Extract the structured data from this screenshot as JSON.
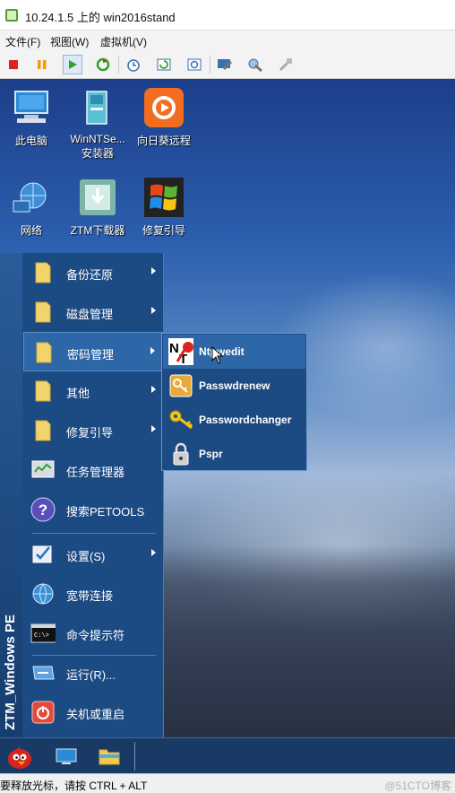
{
  "window": {
    "title": "10.24.1.5 上的 win2016stand"
  },
  "menubar": {
    "file": "文件(F)",
    "view": "视图(W)",
    "vm": "虚拟机(V)"
  },
  "toolbar": {
    "icons": [
      "stop-icon",
      "pause-icon",
      "play-icon",
      "reset-icon",
      "snapshot-icon",
      "revert-icon",
      "snapshot-manager-icon",
      "settings-icon",
      "tools-icon",
      "disabled-tools-icon"
    ]
  },
  "desktop": {
    "icons": [
      {
        "label": "此电脑",
        "icon": "computer-icon"
      },
      {
        "label": "WinNTSe...\n安装器",
        "label1": "WinNTSe...",
        "label2": "安装器",
        "icon": "installer-icon"
      },
      {
        "label": "向日葵远程",
        "icon": "sunflower-icon"
      },
      {
        "label": "网络",
        "icon": "network-icon"
      },
      {
        "label": "ZTM下载器",
        "icon": "download-icon"
      },
      {
        "label": "修复引导",
        "icon": "windows-icon"
      }
    ]
  },
  "startmenu": {
    "brand": "ZTM_Windows PE",
    "items": [
      {
        "label": "备份还原",
        "submenu": true
      },
      {
        "label": "磁盘管理",
        "submenu": true
      },
      {
        "label": "密码管理",
        "submenu": true,
        "highlighted": true
      },
      {
        "label": "其他",
        "submenu": true
      },
      {
        "label": "修复引导",
        "submenu": true
      },
      {
        "label": "任务管理器",
        "submenu": false
      },
      {
        "label": "搜索PETOOLS",
        "submenu": false
      },
      {
        "label": "设置(S)",
        "submenu": true
      },
      {
        "label": "宽带连接",
        "submenu": false
      },
      {
        "label": "命令提示符",
        "submenu": false
      },
      {
        "label": "运行(R)...",
        "submenu": false
      },
      {
        "label": "关机或重启",
        "submenu": false
      }
    ]
  },
  "submenu": {
    "items": [
      {
        "label": "Ntpwedit",
        "highlighted": true
      },
      {
        "label": "Passwdrenew"
      },
      {
        "label": "Passwordchanger"
      },
      {
        "label": "Pspr"
      }
    ]
  },
  "taskbar": {
    "items": [
      "angry-bird-icon",
      "desktop-icon",
      "folder-icon"
    ]
  },
  "statusbar": {
    "text": "要释放光标，请按 CTRL + ALT",
    "watermark": "@51CTO博客"
  },
  "colors": {
    "menu_bg": "#1c4a82",
    "highlight": "#2d67a8"
  }
}
